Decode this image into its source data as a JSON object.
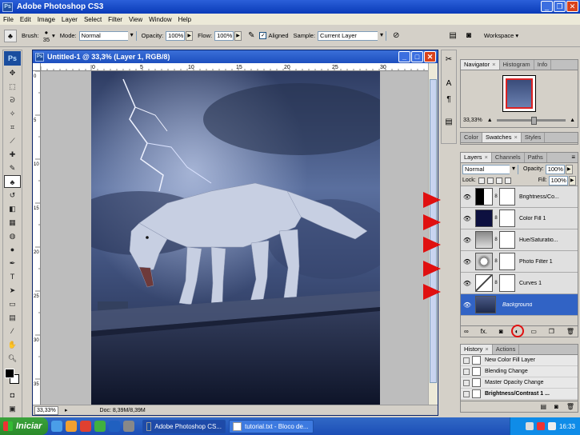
{
  "app": {
    "title": "Adobe Photoshop CS3",
    "logo": "Ps"
  },
  "menu": [
    "File",
    "Edit",
    "Image",
    "Layer",
    "Select",
    "Filter",
    "View",
    "Window",
    "Help"
  ],
  "options_bar": {
    "brush_label": "Brush:",
    "brush_size": "35",
    "mode_label": "Mode:",
    "mode_value": "Normal",
    "opacity_label": "Opacity:",
    "opacity_value": "100%",
    "flow_label": "Flow:",
    "flow_value": "100%",
    "aligned_label": "Aligned",
    "aligned_checked": "✓",
    "sample_label": "Sample:",
    "sample_value": "Current Layer",
    "workspace_label": "Workspace ▾"
  },
  "document": {
    "title": "Untitled-1 @ 33,3% (Layer 1, RGB/8)",
    "zoom": "33,33%",
    "doc_info": "Doc: 8,39M/8,39M",
    "ruler_top": [
      "0",
      "5",
      "10",
      "15",
      "20",
      "25",
      "30"
    ],
    "ruler_left": [
      "0",
      "5",
      "10",
      "15",
      "20",
      "25",
      "30",
      "35"
    ]
  },
  "navigator": {
    "tabs": [
      "Navigator",
      "Histogram",
      "Info"
    ],
    "zoom": "33,33%"
  },
  "swatches": {
    "tabs": [
      "Color",
      "Swatches",
      "Styles"
    ]
  },
  "layers": {
    "tabs": [
      "Layers",
      "Channels",
      "Paths"
    ],
    "blend_mode": "Normal",
    "opacity_label": "Opacity:",
    "opacity_value": "100%",
    "lock_label": "Lock:",
    "fill_label": "Fill:",
    "fill_value": "100%",
    "items": [
      {
        "name": "Brightness/Co...",
        "type": "adjustment"
      },
      {
        "name": "Color Fill 1",
        "type": "fill"
      },
      {
        "name": "Hue/Saturatio...",
        "type": "adjustment"
      },
      {
        "name": "Photo Filter 1",
        "type": "adjustment"
      },
      {
        "name": "Curves 1",
        "type": "adjustment"
      },
      {
        "name": "Background",
        "type": "image"
      }
    ]
  },
  "history": {
    "tabs": [
      "History",
      "Actions"
    ],
    "items": [
      "New Color Fill Layer",
      "Blending Change",
      "Master Opacity Change",
      "Brightness/Contrast 1 ..."
    ]
  },
  "taskbar": {
    "start": "Iniciar",
    "items": [
      "Adobe Photoshop CS...",
      "tutorial.txt - Bloco de..."
    ],
    "clock": "16:33"
  },
  "colors": {
    "accent_arrow": "#e01010",
    "selection": "#3163c5",
    "xp_blue": "#1c4eb6"
  }
}
